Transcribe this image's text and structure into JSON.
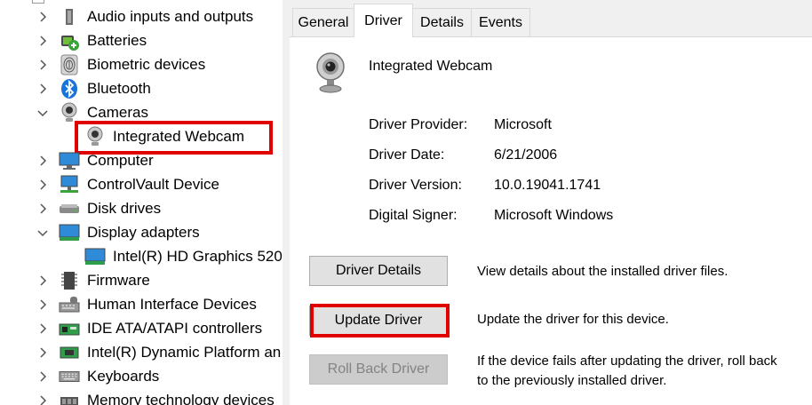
{
  "tree": {
    "items": [
      {
        "label": "Audio inputs and outputs",
        "icon": "speaker-icon",
        "expanded": false
      },
      {
        "label": "Batteries",
        "icon": "battery-icon",
        "expanded": false
      },
      {
        "label": "Biometric devices",
        "icon": "fingerprint-icon",
        "expanded": false
      },
      {
        "label": "Bluetooth",
        "icon": "bluetooth-icon",
        "expanded": false
      },
      {
        "label": "Cameras",
        "icon": "webcam-icon",
        "expanded": true
      },
      {
        "label": "Integrated Webcam",
        "icon": "webcam-icon",
        "child": true
      },
      {
        "label": "Computer",
        "icon": "monitor-icon",
        "expanded": false
      },
      {
        "label": "ControlVault Device",
        "icon": "network-device-icon",
        "expanded": false
      },
      {
        "label": "Disk drives",
        "icon": "disk-drive-icon",
        "expanded": false
      },
      {
        "label": "Display adapters",
        "icon": "display-adapter-icon",
        "expanded": true
      },
      {
        "label": "Intel(R) HD Graphics 520",
        "icon": "display-adapter-icon",
        "child": true
      },
      {
        "label": "Firmware",
        "icon": "firmware-chip-icon",
        "expanded": false
      },
      {
        "label": "Human Interface Devices",
        "icon": "hid-keyboard-icon",
        "expanded": false
      },
      {
        "label": "IDE ATA/ATAPI controllers",
        "icon": "ide-controller-icon",
        "expanded": false
      },
      {
        "label": "Intel(R) Dynamic Platform an",
        "icon": "processor-icon",
        "expanded": false
      },
      {
        "label": "Keyboards",
        "icon": "keyboard-icon",
        "expanded": false
      },
      {
        "label": "Memory technology devices",
        "icon": "memory-icon",
        "expanded": false
      }
    ]
  },
  "tabs": [
    "General",
    "Driver",
    "Details",
    "Events"
  ],
  "active_tab": "Driver",
  "device": {
    "name": "Integrated Webcam",
    "icon": "webcam-icon"
  },
  "driver_info": [
    {
      "key": "Driver Provider:",
      "value": "Microsoft"
    },
    {
      "key": "Driver Date:",
      "value": "6/21/2006"
    },
    {
      "key": "Driver Version:",
      "value": "10.0.19041.1741"
    },
    {
      "key": "Digital Signer:",
      "value": "Microsoft Windows"
    }
  ],
  "buttons": [
    {
      "label": "Driver Details",
      "description": "View details about the installed driver files.",
      "enabled": true
    },
    {
      "label": "Update Driver",
      "description": "Update the driver for this device.",
      "enabled": true
    },
    {
      "label": "Roll Back Driver",
      "description": "If the device fails after updating the driver, roll back to the previously installed driver.",
      "enabled": false
    }
  ],
  "colors": {
    "highlight": "#e00000",
    "dialog_bg": "#f0f0f0",
    "button_bg": "#e1e1e1"
  }
}
